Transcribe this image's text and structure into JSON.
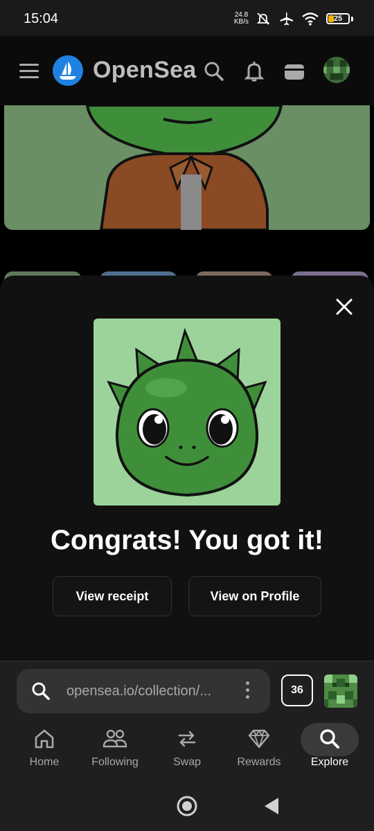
{
  "status_bar": {
    "time": "15:04",
    "net_speed_value": "24.8",
    "net_speed_unit": "KB/s",
    "battery_level": "25",
    "icons": [
      "mute-icon",
      "airplane-icon",
      "wifi-icon",
      "battery-icon"
    ]
  },
  "header": {
    "brand": "OpenSea",
    "icons": [
      "menu-icon",
      "opensea-logo-icon",
      "search-icon",
      "bell-icon",
      "wallet-icon",
      "avatar"
    ]
  },
  "modal": {
    "title": "Congrats! You got it!",
    "view_receipt_label": "View receipt",
    "view_profile_label": "View on Profile"
  },
  "browser": {
    "url": "opensea.io/collection/...",
    "tab_count": "36"
  },
  "nav": {
    "items": [
      {
        "label": "Home",
        "icon": "home-icon"
      },
      {
        "label": "Following",
        "icon": "people-icon"
      },
      {
        "label": "Swap",
        "icon": "swap-icon"
      },
      {
        "label": "Rewards",
        "icon": "diamond-icon"
      },
      {
        "label": "Explore",
        "icon": "search-icon"
      }
    ],
    "active": "Explore"
  },
  "colors": {
    "brand_blue": "#2081e2",
    "nft_background": "#9cd39a",
    "dragon_green": "#3f8f3a",
    "battery_fill": "#f5b301"
  }
}
